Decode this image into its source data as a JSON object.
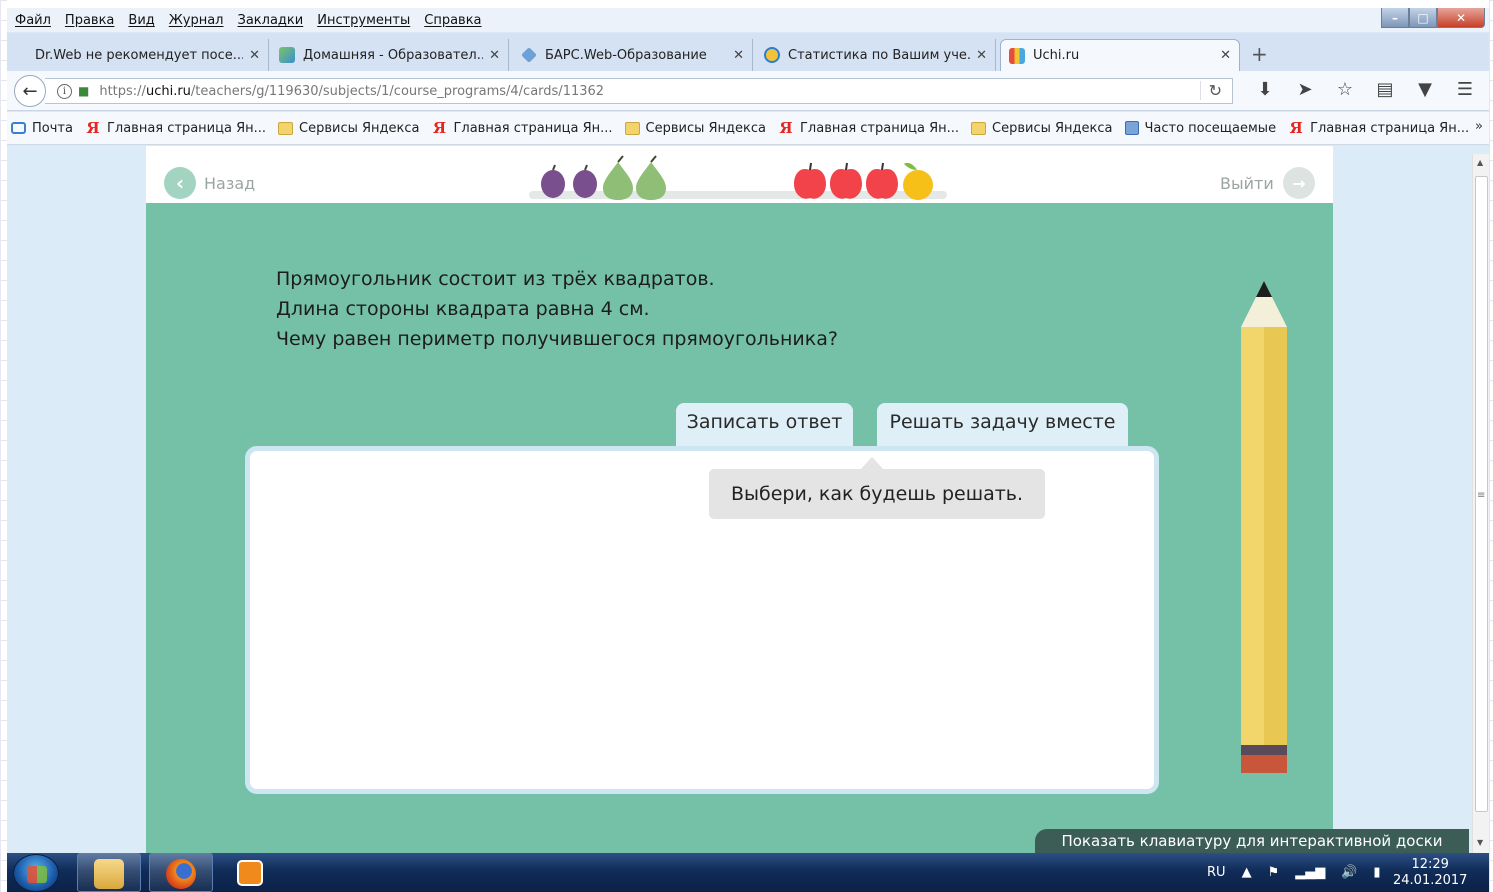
{
  "menu": [
    "Файл",
    "Правка",
    "Вид",
    "Журнал",
    "Закладки",
    "Инструменты",
    "Справка"
  ],
  "window_controls": {
    "minimize": "–",
    "maximize": "□",
    "close": "✕"
  },
  "tabs": [
    {
      "label": "Dr.Web не рекомендует посе...",
      "icon": "drweb-icon"
    },
    {
      "label": "Домашняя - Образовател...",
      "icon": "education-icon"
    },
    {
      "label": "БАРС.Web-Образование",
      "icon": "bars-icon"
    },
    {
      "label": "Статистика по Вашим уче...",
      "icon": "stats-icon"
    },
    {
      "label": "Uchi.ru",
      "icon": "uchi-icon",
      "active": true
    }
  ],
  "newtab": "+",
  "tab_close": "✕",
  "address": {
    "prefix": "https://",
    "domain": "uchi.ru",
    "path": "/teachers/g/119630/subjects/1/course_programs/4/cards/11362"
  },
  "bookmarks": [
    {
      "label": "Почта",
      "icon": "mail"
    },
    {
      "label": "Главная страница Ян...",
      "icon": "ya"
    },
    {
      "label": "Сервисы Яндекса",
      "icon": "folder"
    },
    {
      "label": "Главная страница Ян...",
      "icon": "ya"
    },
    {
      "label": "Сервисы Яндекса",
      "icon": "folder"
    },
    {
      "label": "Главная страница Ян...",
      "icon": "ya"
    },
    {
      "label": "Сервисы Яндекса",
      "icon": "folder"
    },
    {
      "label": "Часто посещаемые",
      "icon": "freq"
    },
    {
      "label": "Главная страница Ян...",
      "icon": "ya"
    }
  ],
  "bookmarks_more": "»",
  "page": {
    "back_label": "Назад",
    "exit_label": "Выйти",
    "question": [
      "Прямоугольник состоит из трёх квадратов.",
      "Длина стороны квадрата равна 4 см.",
      "Чему равен периметр получившегося прямоугольника?"
    ],
    "tab_answer": "Записать ответ",
    "tab_together": "Решать задачу вместе",
    "hint": "Выбери, как будешь решать.",
    "keyboard_button": "Показать клавиатуру для интерактивной доски"
  },
  "colors": {
    "page_bg": "#75c1a7",
    "plum": "#7a4f8e",
    "pear": "#8fbe76",
    "apple": "#f2434b",
    "lemon": "#f6c019"
  },
  "tray": {
    "lang": "RU"
  },
  "clock": {
    "time": "12:29",
    "date": "24.01.2017"
  }
}
